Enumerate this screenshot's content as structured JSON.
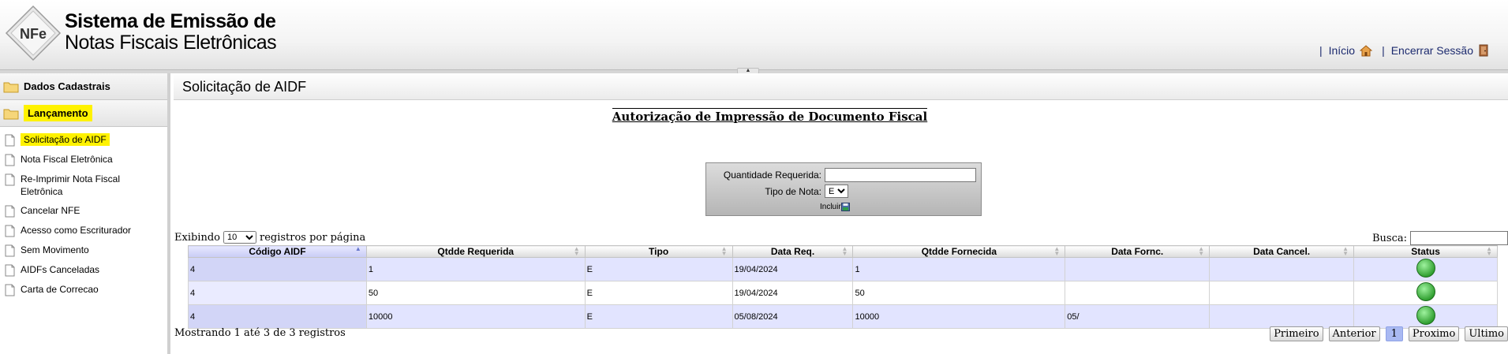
{
  "header": {
    "logo_text": "NFe",
    "title_line1": "Sistema de Emissão de",
    "title_line2": "Notas Fiscais Eletrônicas",
    "nav": {
      "inicio": "Início",
      "encerrar": "Encerrar Sessão",
      "separator": "|"
    }
  },
  "sidebar": {
    "sections": [
      {
        "label": "Dados Cadastrais"
      },
      {
        "label": "Lançamento"
      }
    ],
    "items": [
      {
        "label": "Solicitação de AIDF"
      },
      {
        "label": "Nota Fiscal Eletrônica"
      },
      {
        "label": "Re-Imprimir Nota Fiscal Eletrônica"
      },
      {
        "label": "Cancelar NFE"
      },
      {
        "label": "Acesso como Escriturador"
      },
      {
        "label": "Sem Movimento"
      },
      {
        "label": "AIDFs Canceladas"
      },
      {
        "label": "Carta de Correcao"
      }
    ]
  },
  "main": {
    "page_title": "Solicitação de AIDF",
    "doc_title": "Autorização de Impressão de Documento Fiscal",
    "form": {
      "qtd_label": "Quantidade Requerida:",
      "qtd_value": "",
      "tipo_label": "Tipo de Nota:",
      "tipo_value": "E",
      "incluir_label": "Incluir"
    },
    "length": {
      "prefix": "Exibindo",
      "value": "10",
      "suffix": "registros por página"
    },
    "search": {
      "label": "Busca:",
      "value": ""
    },
    "table": {
      "columns": [
        "Código AIDF",
        "Qtdde Requerida",
        "Tipo",
        "Data Req.",
        "Qtdde Fornecida",
        "Data Fornc.",
        "Data Cancel.",
        "Status"
      ],
      "rows": [
        [
          "4",
          "1",
          "E",
          "19/04/2024",
          "1",
          "",
          "",
          ""
        ],
        [
          "4",
          "50",
          "E",
          "19/04/2024",
          "50",
          "",
          "",
          ""
        ],
        [
          "4",
          "10000",
          "E",
          "05/08/2024",
          "10000",
          "05/",
          "",
          ""
        ]
      ]
    },
    "info": "Mostrando 1 até 3 de 3 registros",
    "pager": {
      "first": "Primeiro",
      "prev": "Anterior",
      "current": "1",
      "next": "Proximo",
      "last": "Ultimo"
    }
  },
  "colors": {
    "highlight": "#fff200",
    "status_green": "#3db83d",
    "nav_link": "#1c2a6e",
    "row_odd": "#e2e4ff"
  },
  "icons": {
    "home": "home-icon",
    "exit": "door-exit-icon",
    "folder": "folder-icon",
    "page": "page-icon",
    "status": "status-green-icon",
    "incluir": "save-icon"
  }
}
